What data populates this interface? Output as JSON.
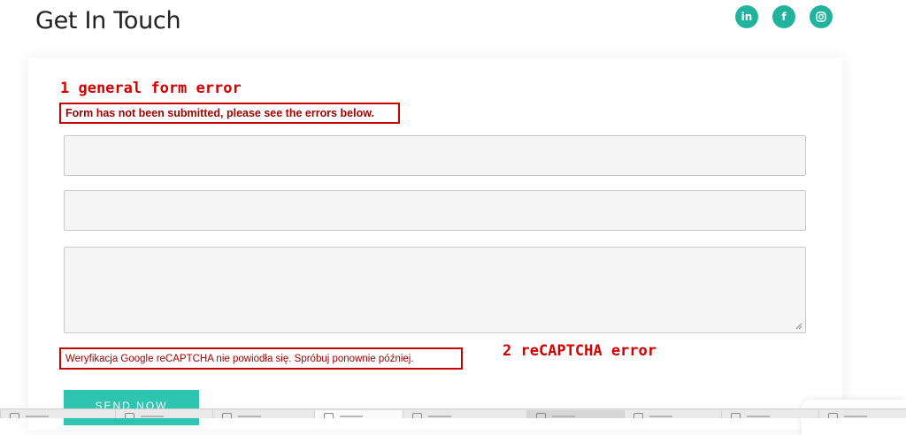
{
  "header": {
    "title": "Get In Touch"
  },
  "social": [
    {
      "name": "linkedin",
      "icon": "linkedin-icon",
      "glyph": "in"
    },
    {
      "name": "facebook",
      "icon": "facebook-icon",
      "glyph": "f"
    },
    {
      "name": "instagram",
      "icon": "instagram-icon",
      "glyph": "◎"
    }
  ],
  "annotations": {
    "general": "1  general form error",
    "recaptcha": "2  reCAPTCHA error"
  },
  "form": {
    "general_error": "Form has not been submitted, please see the errors below.",
    "recaptcha_error": "Weryfikacja Google reCAPTCHA nie powiodła się. Spróbuj ponownie później.",
    "fields": [
      {
        "type": "text",
        "value": ""
      },
      {
        "type": "text",
        "value": ""
      },
      {
        "type": "textarea",
        "value": ""
      }
    ],
    "submit_label": "SEND NOW"
  },
  "colors": {
    "accent": "#2ec4b0",
    "social": "#22b39c",
    "annotation_red": "#d40000",
    "error_text": "#a30000"
  }
}
